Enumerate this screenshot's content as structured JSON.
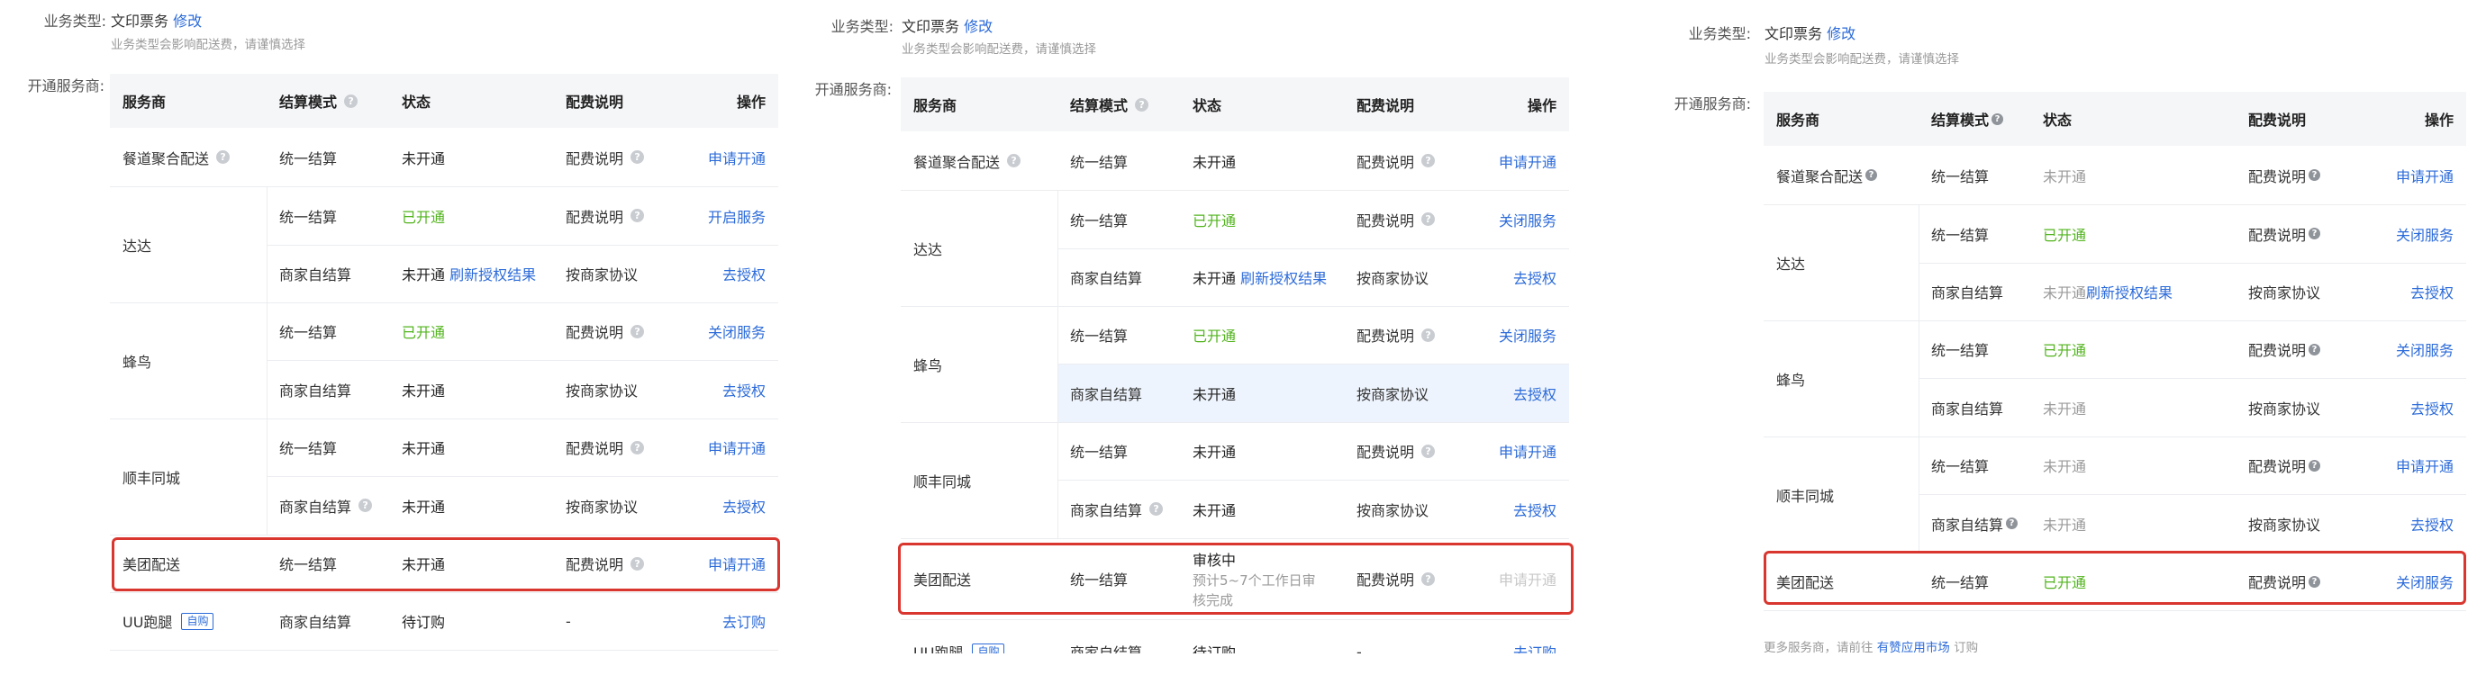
{
  "common": {
    "biz_label": "业务类型:",
    "biz_value": "文印票务",
    "modify": "修改",
    "hint": "业务类型会影响配送费，请谨慎选择",
    "svc_label": "开通服务商:",
    "headers": {
      "provider": "服务商",
      "mode": "结算模式",
      "status": "状态",
      "fee": "配费说明",
      "action": "操作"
    },
    "q_mark": "?"
  },
  "panel1": {
    "rows": [
      {
        "provider": "餐道聚合配送",
        "provider_q": true,
        "mode": "统一结算",
        "status": "未开通",
        "fee": "配费说明",
        "action": "申请开通"
      },
      {
        "provider": "达达",
        "mode": "统一结算",
        "status": "已开通",
        "fee": "配费说明",
        "action": "开启服务"
      },
      {
        "mode": "商家自结算",
        "status": "未开通",
        "status_link": "刷新授权结果",
        "fee": "按商家协议",
        "action": "去授权"
      },
      {
        "provider": "蜂鸟",
        "mode": "统一结算",
        "status": "已开通",
        "fee": "配费说明",
        "action": "关闭服务"
      },
      {
        "mode": "商家自结算",
        "status": "未开通",
        "fee": "按商家协议",
        "action": "去授权"
      },
      {
        "provider": "顺丰同城",
        "mode": "统一结算",
        "status": "未开通",
        "fee": "配费说明",
        "action": "申请开通"
      },
      {
        "mode": "商家自结算",
        "mode_q": true,
        "status": "未开通",
        "fee": "按商家协议",
        "action": "去授权"
      },
      {
        "provider": "美团配送",
        "mode": "统一结算",
        "status": "未开通",
        "fee": "配费说明",
        "action": "申请开通"
      },
      {
        "provider": "UU跑腿",
        "tag": "自购",
        "mode": "商家自结算",
        "status": "待订购",
        "fee": "-",
        "action": "去订购"
      }
    ]
  },
  "panel2": {
    "rows": [
      {
        "provider": "餐道聚合配送",
        "mode": "统一结算",
        "status": "未开通",
        "fee": "配费说明",
        "action": "申请开通"
      },
      {
        "provider": "达达",
        "mode": "统一结算",
        "status": "已开通",
        "fee": "配费说明",
        "action": "关闭服务"
      },
      {
        "mode": "商家自结算",
        "status": "未开通",
        "status_link": "刷新授权结果",
        "fee": "按商家协议",
        "action": "去授权"
      },
      {
        "provider": "蜂鸟",
        "mode": "统一结算",
        "status": "已开通",
        "fee": "配费说明",
        "action": "关闭服务"
      },
      {
        "mode": "商家自结算",
        "status": "未开通",
        "fee": "按商家协议",
        "action": "去授权"
      },
      {
        "provider": "顺丰同城",
        "mode": "统一结算",
        "status": "未开通",
        "fee": "配费说明",
        "action": "申请开通"
      },
      {
        "mode": "商家自结算",
        "status": "未开通",
        "fee": "按商家协议",
        "action": "去授权"
      },
      {
        "provider": "美团配送",
        "mode": "统一结算",
        "status": "审核中",
        "status_sub1": "预计5~7个工作日审",
        "status_sub2": "核完成",
        "fee": "配费说明",
        "action": "申请开通"
      },
      {
        "provider": "UU跑腿",
        "tag": "自购",
        "mode": "商家自结算",
        "status": "待订购",
        "fee": "-",
        "action": "去订购"
      }
    ]
  },
  "panel3": {
    "rows": [
      {
        "provider": "餐道聚合配送",
        "mode": "统一结算",
        "status": "未开通",
        "fee": "配费说明",
        "action": "申请开通"
      },
      {
        "provider": "达达",
        "mode": "统一结算",
        "status": "已开通",
        "fee": "配费说明",
        "action": "关闭服务"
      },
      {
        "mode": "商家自结算",
        "status": "未开通",
        "status_link": "刷新授权结果",
        "fee": "按商家协议",
        "action": "去授权"
      },
      {
        "provider": "蜂鸟",
        "mode": "统一结算",
        "status": "已开通",
        "fee": "配费说明",
        "action": "关闭服务"
      },
      {
        "mode": "商家自结算",
        "status": "未开通",
        "fee": "按商家协议",
        "action": "去授权"
      },
      {
        "provider": "顺丰同城",
        "mode": "统一结算",
        "status": "未开通",
        "fee": "配费说明",
        "action": "申请开通"
      },
      {
        "mode": "商家自结算",
        "status": "未开通",
        "fee": "按商家协议",
        "action": "去授权"
      },
      {
        "provider": "美团配送",
        "mode": "统一结算",
        "status": "已开通",
        "fee": "配费说明",
        "action": "关闭服务"
      }
    ],
    "footer_prefix": "更多服务商，请前往",
    "footer_link": "有赞应用市场",
    "footer_suffix": "订购"
  }
}
